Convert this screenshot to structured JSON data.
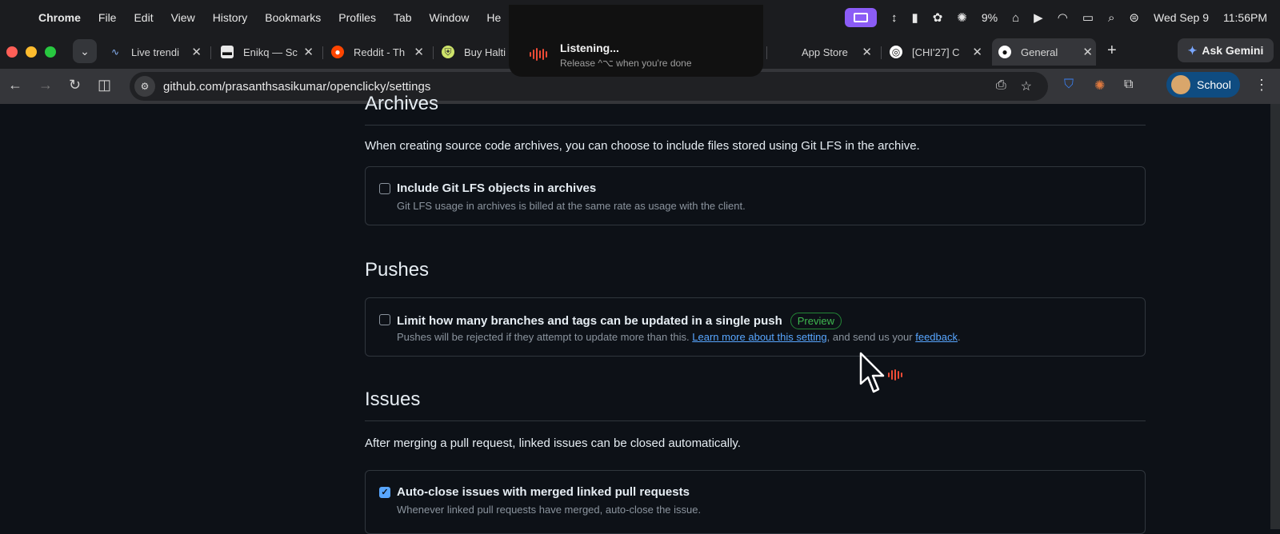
{
  "menubar": {
    "app": "Chrome",
    "items": [
      "File",
      "Edit",
      "View",
      "History",
      "Bookmarks",
      "Profiles",
      "Tab",
      "Window",
      "He"
    ],
    "battery": "9%",
    "date": "Wed Sep 9",
    "time": "11:56PM"
  },
  "tabs": [
    {
      "title": "Live trendi",
      "icon": "chart-icon"
    },
    {
      "title": "Enikq — Sc",
      "icon": "enikq-icon"
    },
    {
      "title": "Reddit - Th",
      "icon": "reddit-icon"
    },
    {
      "title": "Buy Halti",
      "icon": "shield-icon"
    },
    {
      "title": "App Store",
      "icon": "apple-icon"
    },
    {
      "title": "[CHI'27] C",
      "icon": "openai-icon"
    },
    {
      "title": "General",
      "icon": "github-icon",
      "active": true
    }
  ],
  "gemini_label": "Ask Gemini",
  "url": "github.com/prasanthsasikumar/openclicky/settings",
  "profile_label": "School",
  "listening": {
    "title": "Listening...",
    "subtitle": "Release ^⌥ when you're done"
  },
  "sections": {
    "archives": {
      "heading": "Archives",
      "description": "When creating source code archives, you can choose to include files stored using Git LFS in the archive.",
      "option_title": "Include Git LFS objects in archives",
      "option_desc": "Git LFS usage in archives is billed at the same rate as usage with the client.",
      "checked": false
    },
    "pushes": {
      "heading": "Pushes",
      "option_title": "Limit how many branches and tags can be updated in a single push",
      "badge": "Preview",
      "desc_prefix": "Pushes will be rejected if they attempt to update more than this. ",
      "link1": "Learn more about this setting",
      "desc_middle": ", and send us your ",
      "link2": "feedback",
      "desc_suffix": ".",
      "checked": false
    },
    "issues": {
      "heading": "Issues",
      "description": "After merging a pull request, linked issues can be closed automatically.",
      "option_title": "Auto-close issues with merged linked pull requests",
      "option_desc": "Whenever linked pull requests have merged, auto-close the issue.",
      "checked": true
    }
  }
}
